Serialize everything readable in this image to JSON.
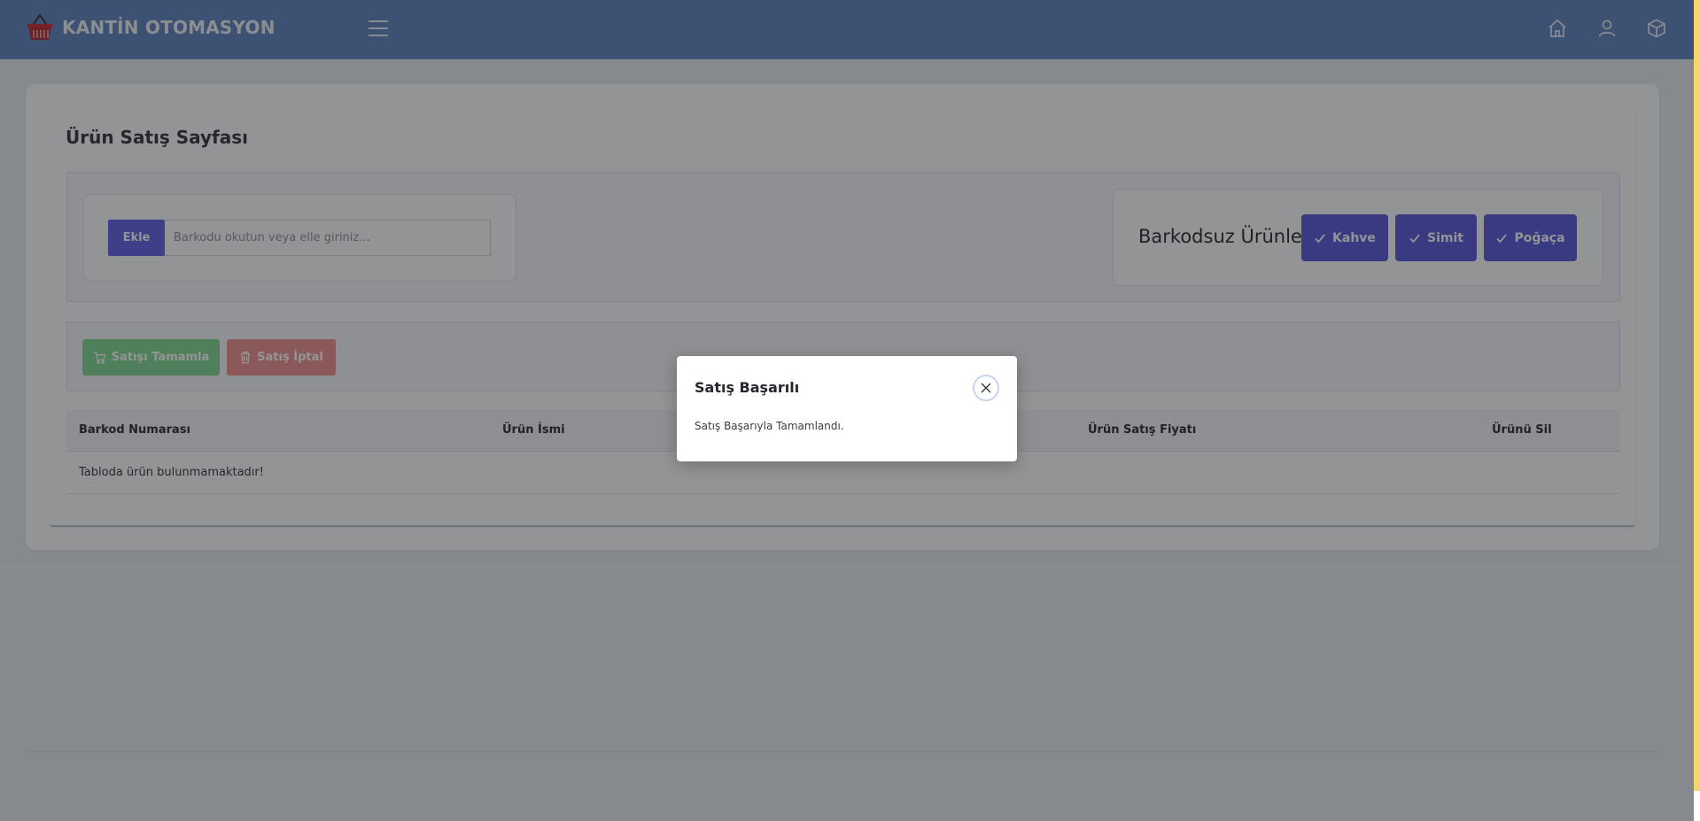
{
  "navbar": {
    "brand_title": "KANTİN OTOMASYON",
    "icons": [
      "basket-icon",
      "menu-icon",
      "home-icon",
      "user-icon",
      "box-icon"
    ],
    "accent_color": "#5b7fbd"
  },
  "page": {
    "title": "Ürün Satış Sayfası"
  },
  "barcode": {
    "add_label": "Ekle",
    "placeholder": "Barkodu okutun veya elle giriniz..."
  },
  "barcodeless": {
    "label": "Barkodsuz Ürünler",
    "products": [
      "Kahve",
      "Simit",
      "Poğaça"
    ]
  },
  "actions": {
    "complete_label": "Satışı Tamamla",
    "cancel_label": "Satış İptal"
  },
  "table": {
    "headers": [
      "Barkod Numarası",
      "Ürün İsmi",
      "Ürün Satış Fiyatı",
      "Ürünü Sil"
    ],
    "empty_message": "Tabloda ürün bulunmamaktadır!"
  },
  "modal": {
    "title": "Satış Başarılı",
    "message": "Satış Başarıyla Tamamlandı."
  }
}
